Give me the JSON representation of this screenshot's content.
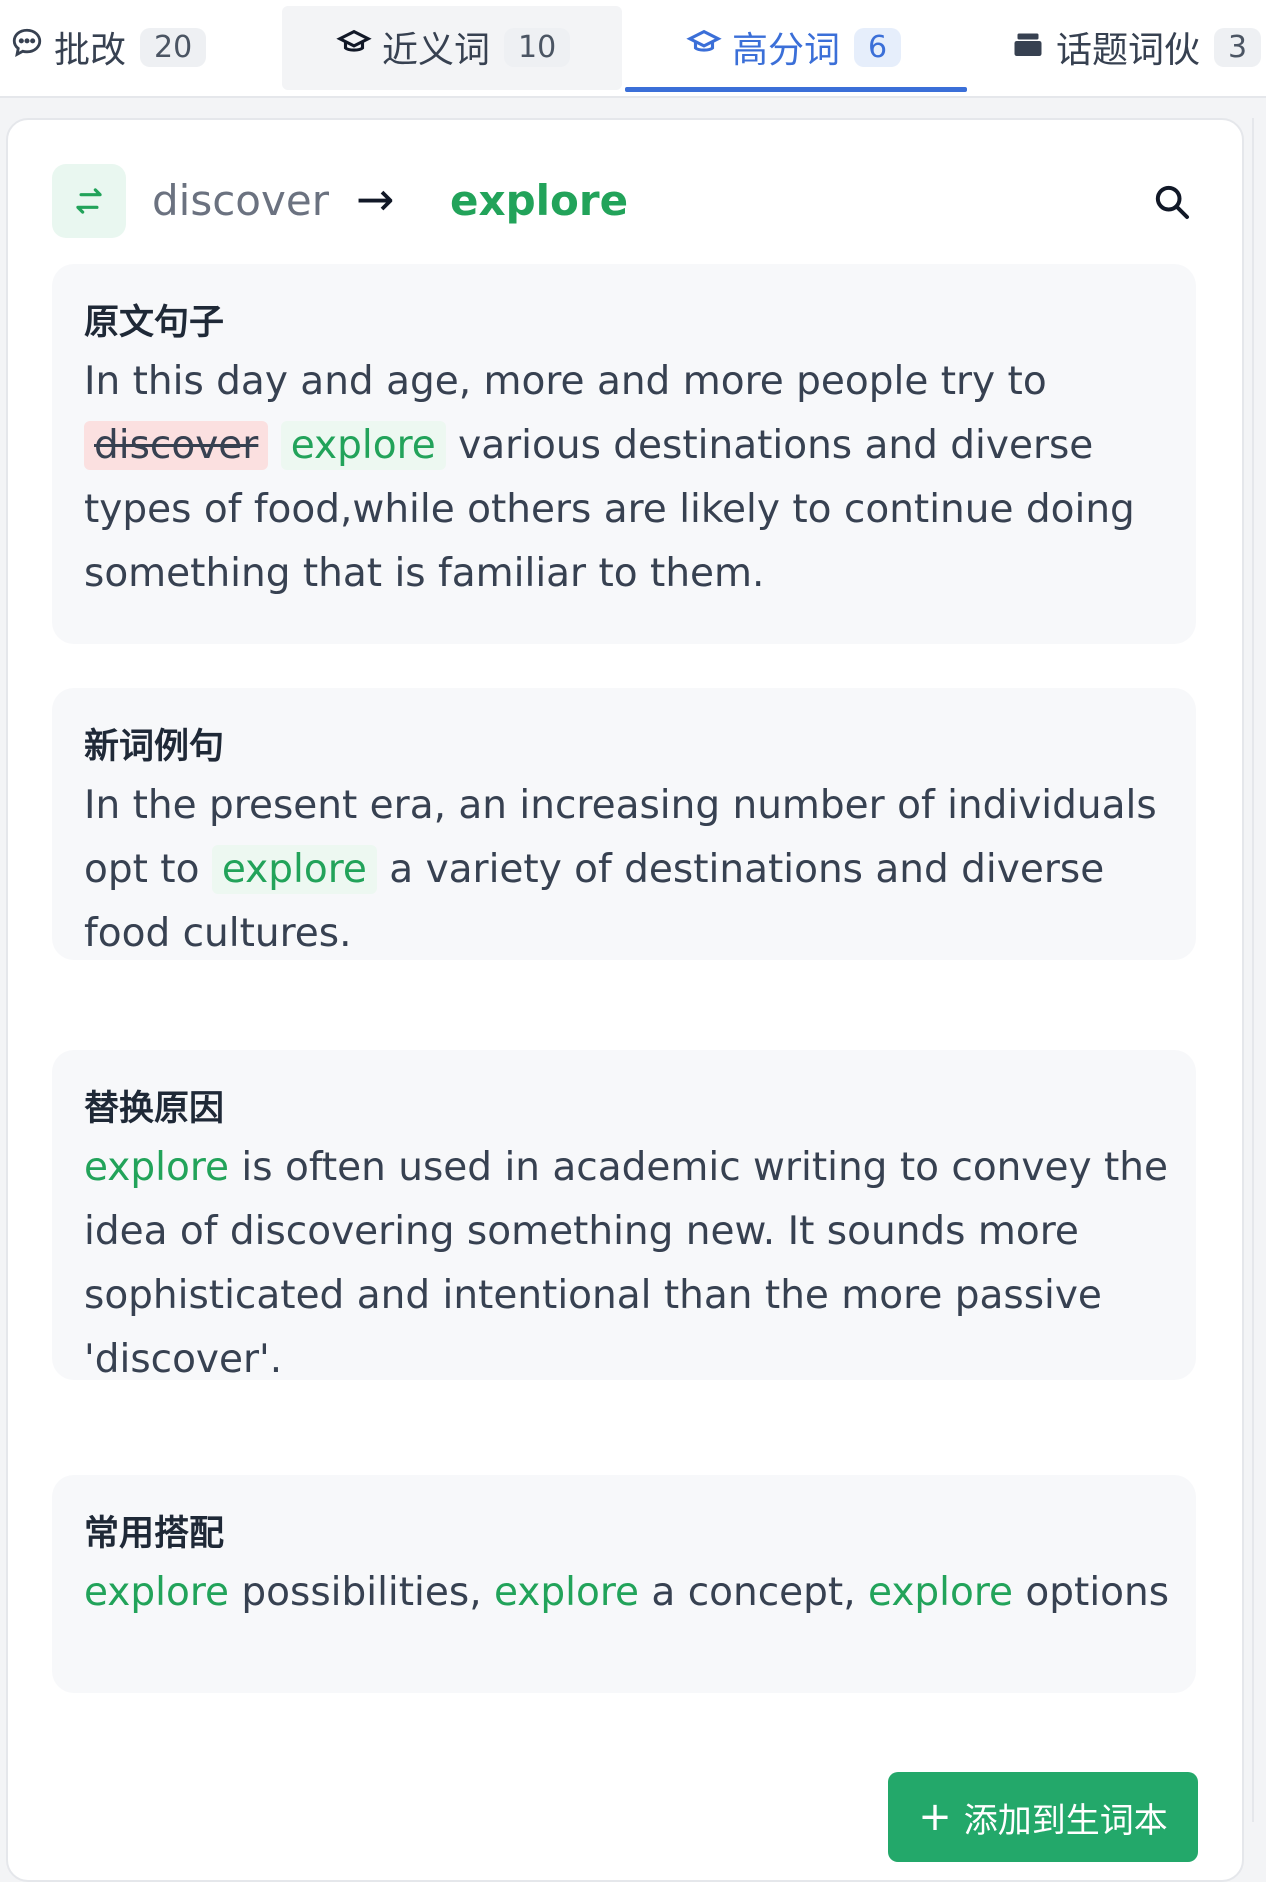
{
  "tabs": [
    {
      "label": "批改",
      "count": "20"
    },
    {
      "label": "近义词",
      "count": "10"
    },
    {
      "label": "高分词",
      "count": "6"
    },
    {
      "label": "话题词伙",
      "count": "3"
    }
  ],
  "active_tab": "高分词",
  "colors": {
    "accent_blue": "#3b6fd8",
    "green": "#22a35a",
    "button_green": "#23a86a",
    "strike_bg": "#fbe0e0"
  },
  "word": {
    "original": "discover",
    "arrow": "→",
    "replacement": "explore"
  },
  "sections": {
    "original_sentence": {
      "title": "原文句子",
      "before": "In this day and age, more and more people try to ",
      "removed": "discover",
      "inserted": "explore",
      "after": " various destinations and diverse types of food,while others are likely to continue doing something that is familiar to them."
    },
    "example_sentence": {
      "title": "新词例句",
      "before": "In the present era, an increasing number of individuals opt to ",
      "highlight": "explore",
      "after": " a variety of destinations and diverse food cultures."
    },
    "reason": {
      "title": "替换原因",
      "highlight": "explore",
      "after": " is often used in academic writing to convey the idea of discovering something new. It sounds more sophisticated and intentional than the more passive 'discover'."
    },
    "collocations": {
      "title": "常用搭配",
      "items": [
        {
          "word": "explore",
          "rest": " possibilities, "
        },
        {
          "word": "explore",
          "rest": " a concept, "
        },
        {
          "word": "explore",
          "rest": " options"
        }
      ]
    }
  },
  "add_button": {
    "icon": "+",
    "label": "添加到生词本"
  },
  "icons": [
    "comment-icon",
    "graduation-cap-icon",
    "graduation-cap-icon",
    "stack-icon",
    "swap-icon",
    "search-icon",
    "plus-icon"
  ]
}
